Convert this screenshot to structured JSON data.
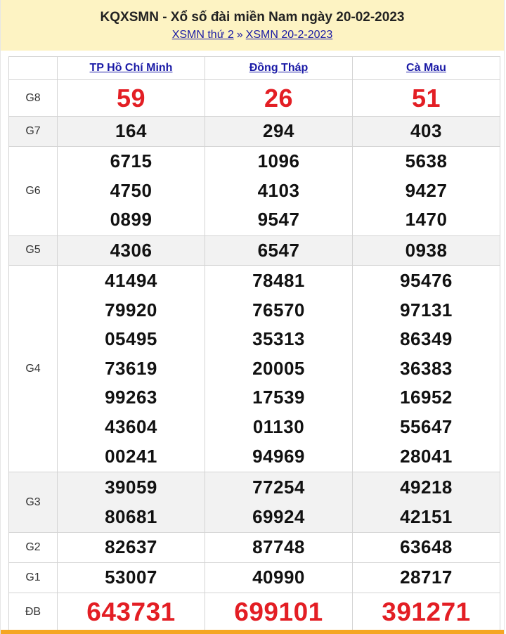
{
  "header": {
    "title": "KQXSMN - Xổ số đài miền Nam ngày 20-02-2023",
    "breadcrumb": {
      "link1": "XSMN thứ 2",
      "separator": "»",
      "link2": "XSMN 20-2-2023"
    }
  },
  "provinces": [
    "TP Hồ Chí Minh",
    "Đồng Tháp",
    "Cà Mau"
  ],
  "prizes": {
    "g8": {
      "label": "G8",
      "values": [
        [
          "59"
        ],
        [
          "26"
        ],
        [
          "51"
        ]
      ]
    },
    "g7": {
      "label": "G7",
      "values": [
        [
          "164"
        ],
        [
          "294"
        ],
        [
          "403"
        ]
      ]
    },
    "g6": {
      "label": "G6",
      "values": [
        [
          "6715",
          "4750",
          "0899"
        ],
        [
          "1096",
          "4103",
          "9547"
        ],
        [
          "5638",
          "9427",
          "1470"
        ]
      ]
    },
    "g5": {
      "label": "G5",
      "values": [
        [
          "4306"
        ],
        [
          "6547"
        ],
        [
          "0938"
        ]
      ]
    },
    "g4": {
      "label": "G4",
      "values": [
        [
          "41494",
          "79920",
          "05495",
          "73619",
          "99263",
          "43604",
          "00241"
        ],
        [
          "78481",
          "76570",
          "35313",
          "20005",
          "17539",
          "01130",
          "94969"
        ],
        [
          "95476",
          "97131",
          "86349",
          "36383",
          "16952",
          "55647",
          "28041"
        ]
      ]
    },
    "g3": {
      "label": "G3",
      "values": [
        [
          "39059",
          "80681"
        ],
        [
          "77254",
          "69924"
        ],
        [
          "49218",
          "42151"
        ]
      ]
    },
    "g2": {
      "label": "G2",
      "values": [
        [
          "82637"
        ],
        [
          "87748"
        ],
        [
          "63648"
        ]
      ]
    },
    "g1": {
      "label": "G1",
      "values": [
        [
          "53007"
        ],
        [
          "40990"
        ],
        [
          "28717"
        ]
      ]
    },
    "db": {
      "label": "ĐB",
      "values": [
        [
          "643731"
        ],
        [
          "699101"
        ],
        [
          "391271"
        ]
      ]
    }
  },
  "colors": {
    "header_bg": "#fdf3c3",
    "link": "#1a1aa6",
    "highlight_red": "#e31e24",
    "row_shade": "#f2f2f2",
    "bottom_bar": "#f5a623"
  }
}
